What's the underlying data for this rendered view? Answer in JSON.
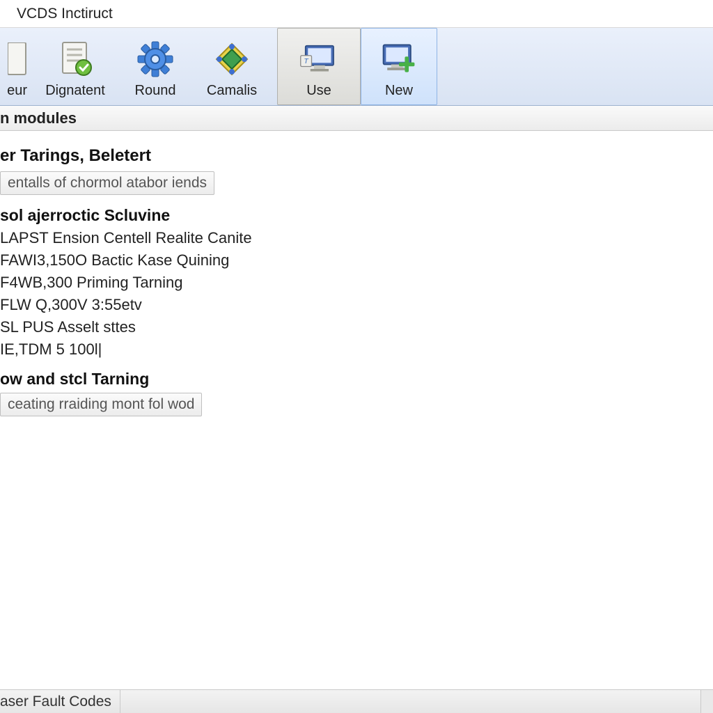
{
  "window": {
    "title": "VCDS Inctiruct"
  },
  "toolbar": {
    "items": [
      {
        "label": "eur"
      },
      {
        "label": "Dignatent"
      },
      {
        "label": "Round"
      },
      {
        "label": "Camalis"
      },
      {
        "label": "Use"
      },
      {
        "label": "New"
      }
    ]
  },
  "section_header": "n modules",
  "group1": {
    "title": "er Tarings, Beletert",
    "button": "entalls of chormol atabor iends"
  },
  "group2": {
    "title": "sol ajerroctic Scluvine",
    "lines": [
      "LAPST Ension Centell Realite Canite",
      "FAWI3,150O Bactic Kase Quining",
      "F4WB,300 Priming Tarning",
      "FLW Q,300V 3:55etv",
      "SL PUS Asselt sttes",
      "IE,TDM 5 100l|"
    ]
  },
  "group3": {
    "title": "ow and stcl Tarning",
    "button": "ceating rraiding mont fol wod"
  },
  "status": {
    "text": "aser Fault Codes"
  }
}
